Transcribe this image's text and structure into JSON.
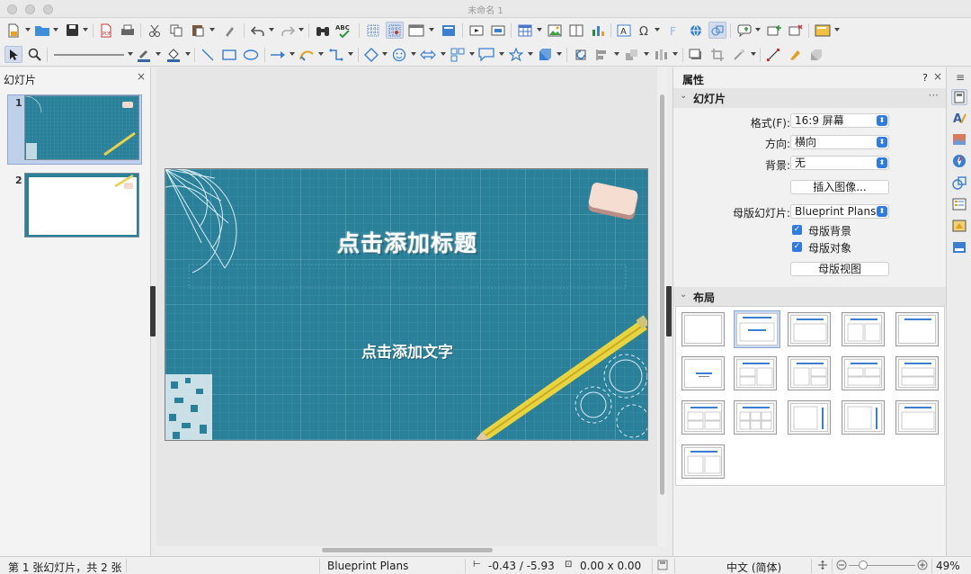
{
  "window": {
    "title": "未命名 1"
  },
  "slides_pane": {
    "title": "幻灯片",
    "close": "×",
    "thumbs": [
      {
        "number": "1"
      },
      {
        "number": "2"
      }
    ]
  },
  "slide": {
    "title_placeholder": "点击添加标题",
    "body_placeholder": "点击添加文字",
    "background_color": "#2a7f99"
  },
  "properties": {
    "title": "属性",
    "help": "?",
    "close": "×",
    "slide_section": {
      "label": "幻灯片",
      "more": "···",
      "format_label": "格式(F):",
      "format_value": "16:9 屏幕",
      "orientation_label": "方向:",
      "orientation_value": "横向",
      "background_label": "背景:",
      "background_value": "无",
      "insert_image": "插入图像...",
      "master_label": "母版幻灯片:",
      "master_value": "Blueprint Plans",
      "master_background": "母版背景",
      "master_objects": "母版对象",
      "master_view": "母版视图"
    },
    "layout_section": {
      "label": "布局"
    }
  },
  "status_bar": {
    "slide_info": "第 1 张幻灯片，共 2 张",
    "master_name": "Blueprint Plans",
    "position": "-0.43 / -5.93",
    "size": "0.00 x 0.00",
    "language": "中文 (简体)",
    "zoom": "49%"
  },
  "colors": {
    "accent": "#2f7be6",
    "selection": "#c8d8ef"
  }
}
